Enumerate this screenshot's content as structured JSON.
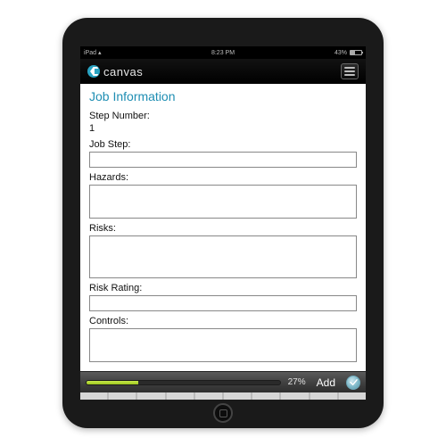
{
  "statusbar": {
    "carrier": "iPad",
    "wifi": "▴",
    "time": "8:23 PM",
    "battery_pct": "43%"
  },
  "appbar": {
    "brand": "canvas"
  },
  "section_title": "Job Information",
  "fields": {
    "step_number": {
      "label": "Step Number:",
      "value": "1"
    },
    "job_step": {
      "label": "Job Step:",
      "value": ""
    },
    "hazards": {
      "label": "Hazards:",
      "value": ""
    },
    "risks": {
      "label": "Risks:",
      "value": ""
    },
    "risk_rating": {
      "label": "Risk Rating:",
      "value": ""
    },
    "controls": {
      "label": "Controls:",
      "value": ""
    }
  },
  "footer": {
    "progress_pct": "27%",
    "progress_value": 27,
    "add_label": "Add"
  },
  "colors": {
    "accent": "#1f8eb3",
    "progress": "#9ec71f"
  }
}
